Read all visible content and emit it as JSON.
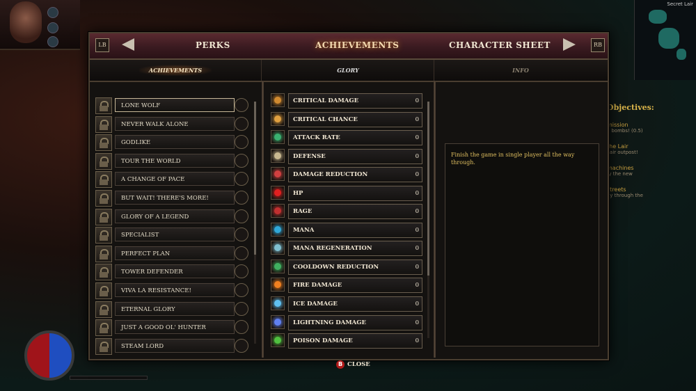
{
  "hud": {
    "minimap_label": "Secret Lair",
    "objectives": {
      "header": "Objectives:",
      "items": [
        {
          "title": "mission",
          "sub": "y bombs! (0.5)"
        },
        {
          "title": "the Lair",
          "sub": "Lair outpost!"
        },
        {
          "title": "machines",
          "sub": "fy the new"
        },
        {
          "title": "streets",
          "sub": "ay through the"
        }
      ]
    }
  },
  "top_nav": {
    "left_key": "LB",
    "right_key": "RB",
    "tabs": [
      "PERKS",
      "ACHIEVEMENTS",
      "CHARACTER SHEET"
    ],
    "active_tab": "ACHIEVEMENTS"
  },
  "sub_nav": {
    "tabs": [
      "ACHIEVEMENTS",
      "GLORY",
      "INFO"
    ],
    "active_tab": "ACHIEVEMENTS"
  },
  "achievements": [
    "LONE WOLF",
    "NEVER WALK ALONE",
    "GODLIKE",
    "TOUR THE WORLD",
    "A CHANGE OF PACE",
    "BUT WAIT! THERE'S MORE!",
    "GLORY OF A LEGEND",
    "SPECIALIST",
    "PERFECT PLAN",
    "TOWER DEFENDER",
    "VIVA LA RESISTANCE!",
    "ETERNAL GLORY",
    "JUST A GOOD OL' HUNTER",
    "STEAM LORD"
  ],
  "glory": [
    {
      "name": "CRITICAL DAMAGE",
      "value": "0",
      "icon": "critical-damage-icon",
      "color": "#d08a30"
    },
    {
      "name": "CRITICAL CHANCE",
      "value": "0",
      "icon": "critical-chance-icon",
      "color": "#e0a040"
    },
    {
      "name": "ATTACK RATE",
      "value": "0",
      "icon": "attack-rate-icon",
      "color": "#3ab070"
    },
    {
      "name": "DEFENSE",
      "value": "0",
      "icon": "defense-icon",
      "color": "#c8b890"
    },
    {
      "name": "DAMAGE REDUCTION",
      "value": "0",
      "icon": "damage-reduction-icon",
      "color": "#d04040"
    },
    {
      "name": "HP",
      "value": "0",
      "icon": "hp-icon",
      "color": "#e02020"
    },
    {
      "name": "RAGE",
      "value": "0",
      "icon": "rage-icon",
      "color": "#c03030"
    },
    {
      "name": "MANA",
      "value": "0",
      "icon": "mana-icon",
      "color": "#30a8d8"
    },
    {
      "name": "MANA REGENERATION",
      "value": "0",
      "icon": "mana-regeneration-icon",
      "color": "#80c0d0"
    },
    {
      "name": "COOLDOWN REDUCTION",
      "value": "0",
      "icon": "cooldown-reduction-icon",
      "color": "#40b060"
    },
    {
      "name": "FIRE DAMAGE",
      "value": "0",
      "icon": "fire-damage-icon",
      "color": "#f08020"
    },
    {
      "name": "ICE DAMAGE",
      "value": "0",
      "icon": "ice-damage-icon",
      "color": "#60c0f0"
    },
    {
      "name": "LIGHTNING DAMAGE",
      "value": "0",
      "icon": "lightning-damage-icon",
      "color": "#6080f0"
    },
    {
      "name": "POISON DAMAGE",
      "value": "0",
      "icon": "poison-damage-icon",
      "color": "#50c040"
    }
  ],
  "info": {
    "description": "Finish the game in single player all the way through."
  },
  "footer": {
    "close_key": "B",
    "close_label": "CLOSE"
  }
}
